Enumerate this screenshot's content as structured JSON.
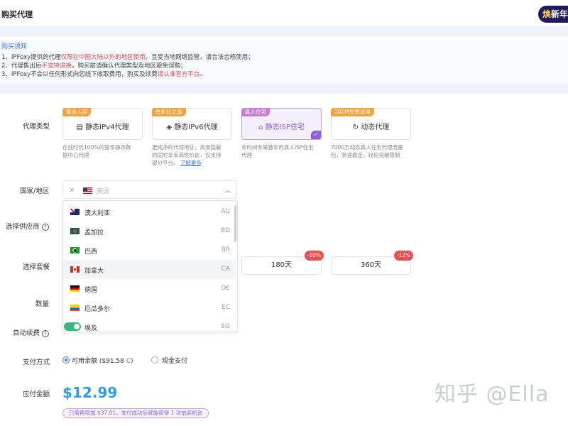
{
  "header": {
    "title": "购买代理",
    "promo_badge_prefix": "焕",
    "promo_badge_text": "新年"
  },
  "notice": {
    "title": "购买须知",
    "lines": [
      {
        "a": "1、IPFoxy提供的代理",
        "b": "仅限在中国大陆以外的地区使用",
        "c": "，且受当地网络监管，请合法合规使用；"
      },
      {
        "a": "2、代理售出后",
        "b": "不支持退换",
        "c": "，购买前请确认代理类型及地区避免误购；"
      },
      {
        "a": "3、IPFoxy不会以任何形式向您线下收取费用，购买及续费",
        "b": "请认准官方平台",
        "c": "。"
      }
    ]
  },
  "labels": {
    "proxy_type": "代理类型",
    "country": "国家/地区",
    "provider": "选择供应商",
    "package": "选择套餐",
    "quantity": "数量",
    "auto_renew": "自动续费",
    "payment": "支付方式",
    "amount": "应付金额"
  },
  "proxy_types": [
    {
      "tag": "最多人用",
      "name": "静态IPv4代理",
      "icon": "server-icon",
      "desc": [
        "在线时长100%的独享静态数",
        "据中心代理"
      ],
      "selected": false
    },
    {
      "tag": "性价比之选",
      "name": "静态IPv6代理",
      "icon": "layers-icon",
      "desc": [
        "更纯净的代理地址，高度隐蔽",
        "的同时享有高性价比，仅支持",
        "部分平台。"
      ],
      "link": "了解更多",
      "selected": false
    },
    {
      "tag": "真人住宅",
      "name": "静态ISP住宅",
      "icon": "home-icon",
      "desc": [
        "长时间专属独享的真人ISP住宅",
        "代理"
      ],
      "selected": true
    },
    {
      "tag": "200M免费试用",
      "name": "动态代理",
      "icon": "refresh-icon",
      "desc": [
        "7000万动态真人住宅代理流量",
        "包，高速稳定，轻松突破限制"
      ],
      "selected": false
    }
  ],
  "country_select": {
    "search_icon": "search-icon",
    "value": "美国",
    "chevron": "chevron-up-icon"
  },
  "countries": [
    {
      "name": "澳大利亚",
      "code": "AU",
      "flag": "flag-au",
      "hover": false
    },
    {
      "name": "孟加拉",
      "code": "BD",
      "flag": "flag-bd",
      "hover": false
    },
    {
      "name": "巴西",
      "code": "BR",
      "flag": "flag-br",
      "hover": false
    },
    {
      "name": "加拿大",
      "code": "CA",
      "flag": "flag-ca",
      "hover": true
    },
    {
      "name": "德国",
      "code": "DE",
      "flag": "flag-de",
      "hover": false
    },
    {
      "name": "厄瓜多尔",
      "code": "EC",
      "flag": "flag-ec",
      "hover": false
    },
    {
      "name": "埃及",
      "code": "EG",
      "flag": "flag-eg",
      "hover": false
    }
  ],
  "packages": [
    {
      "label": "180天",
      "discount": "-10%"
    },
    {
      "label": "360天",
      "discount": "-12%"
    }
  ],
  "payment": {
    "balance_label": "可用余额 ($91.58",
    "balance_refresh": "C",
    "balance_close": ")",
    "cash_label": "现金支付",
    "selected": "balance"
  },
  "price": "$12.99",
  "promo_note": "只需再增加 $37.01，支付成功后就能获得 1 次抽奖机会",
  "watermark": "知乎 @Ella",
  "colors": {
    "accent": "#3c7bf6",
    "purple": "#8a5fe0",
    "price": "#2d9cf0",
    "orange_tag": "#f4a23c",
    "red": "#e5484d"
  }
}
